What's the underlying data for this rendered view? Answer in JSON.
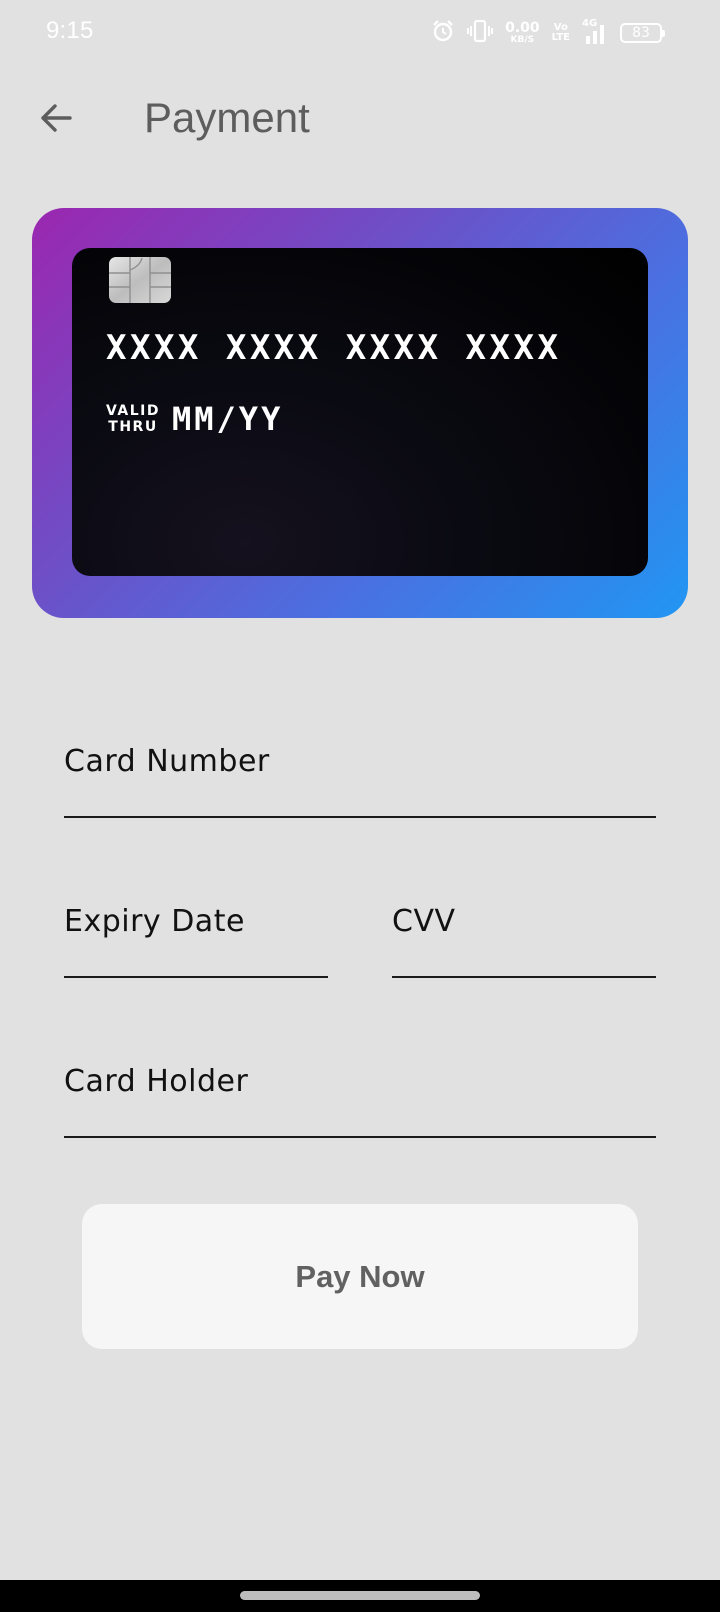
{
  "status_bar": {
    "time": "9:15",
    "net_speed_value": "0.00",
    "net_speed_unit": "KB/S",
    "volte_top": "Vo",
    "volte_bottom": "LTE",
    "signal_label": "4G",
    "battery": "83",
    "icons": [
      "alarm-icon",
      "vibrate-icon",
      "signal-icon"
    ]
  },
  "header": {
    "title": "Payment",
    "back_icon": "arrow-left-icon"
  },
  "card_preview": {
    "number": "XXXX XXXX XXXX XXXX",
    "valid_label_top": "VALID",
    "valid_label_bottom": "THRU",
    "expiry": "MM/YY",
    "gradient_colors": [
      "#9b27b0",
      "#2196f3"
    ],
    "chip_icon": "card-chip-icon"
  },
  "form": {
    "card_number_label": "Card Number",
    "expiry_label": "Expiry Date",
    "cvv_label": "CVV",
    "holder_label": "Card Holder",
    "card_number_value": "",
    "expiry_value": "",
    "cvv_value": "",
    "holder_value": ""
  },
  "actions": {
    "pay_label": "Pay Now"
  }
}
